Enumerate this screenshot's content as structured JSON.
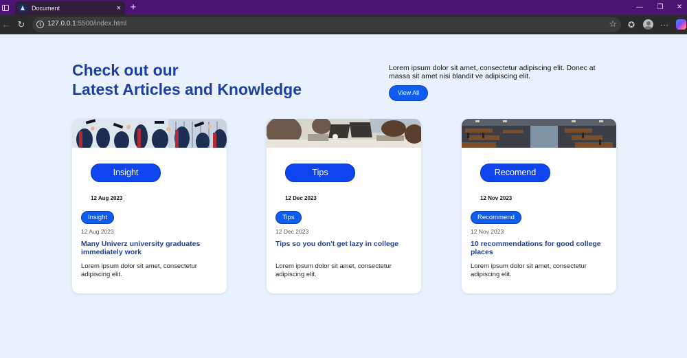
{
  "browser": {
    "tab_title": "Document",
    "url_host": "127.0.0.1",
    "url_rest": ":5500/index.html",
    "new_tab_glyph": "+",
    "close_glyph": "×",
    "icons": {
      "sidebar": "sidebar-icon",
      "back": "back-icon",
      "refresh": "refresh-icon",
      "info": "info-icon",
      "favorite": "star-icon",
      "collections": "collections-icon",
      "profile": "avatar",
      "menu": "more-icon",
      "copilot": "copilot-icon"
    }
  },
  "header": {
    "heading_line1": "Check out our",
    "heading_line2": "Latest Articles and Knowledge",
    "intro": "Lorem ipsum dolor sit amet, consectetur adipiscing elit. Donec at massa sit amet nisi blandit ve adipiscing elit.",
    "view_all_label": "View All"
  },
  "cards": [
    {
      "image": "graduation-photo",
      "pill_label": "Insight",
      "pill_date": "12 Aug 2023",
      "badge": "Insight",
      "date": "12 Aug 2023",
      "title": "Many Univerz university graduates immediately work",
      "text": "Lorem ipsum dolor sit amet, consectetur adipiscing elit."
    },
    {
      "image": "students-laptops-photo",
      "pill_label": "Tips",
      "pill_date": "12 Dec 2023",
      "badge": "Tips",
      "date": "12 Dec 2023",
      "title": "Tips so you don't get lazy in college",
      "text": "Lorem ipsum dolor sit amet, consectetur adipiscing elit."
    },
    {
      "image": "library-photo",
      "pill_label": "Recomend",
      "pill_date": "12 Nov 2023",
      "badge": "Recommend",
      "date": "12 Nov 2023",
      "title": "10 recommendations for good college places",
      "text": "Lorem ipsum dolor sit amet, consectetur adipiscing elit."
    }
  ],
  "colors": {
    "tabbar": "#4a1570",
    "page_bg": "#e8f1fd",
    "heading": "#1d3f9e",
    "accent": "#0f5cf0"
  }
}
